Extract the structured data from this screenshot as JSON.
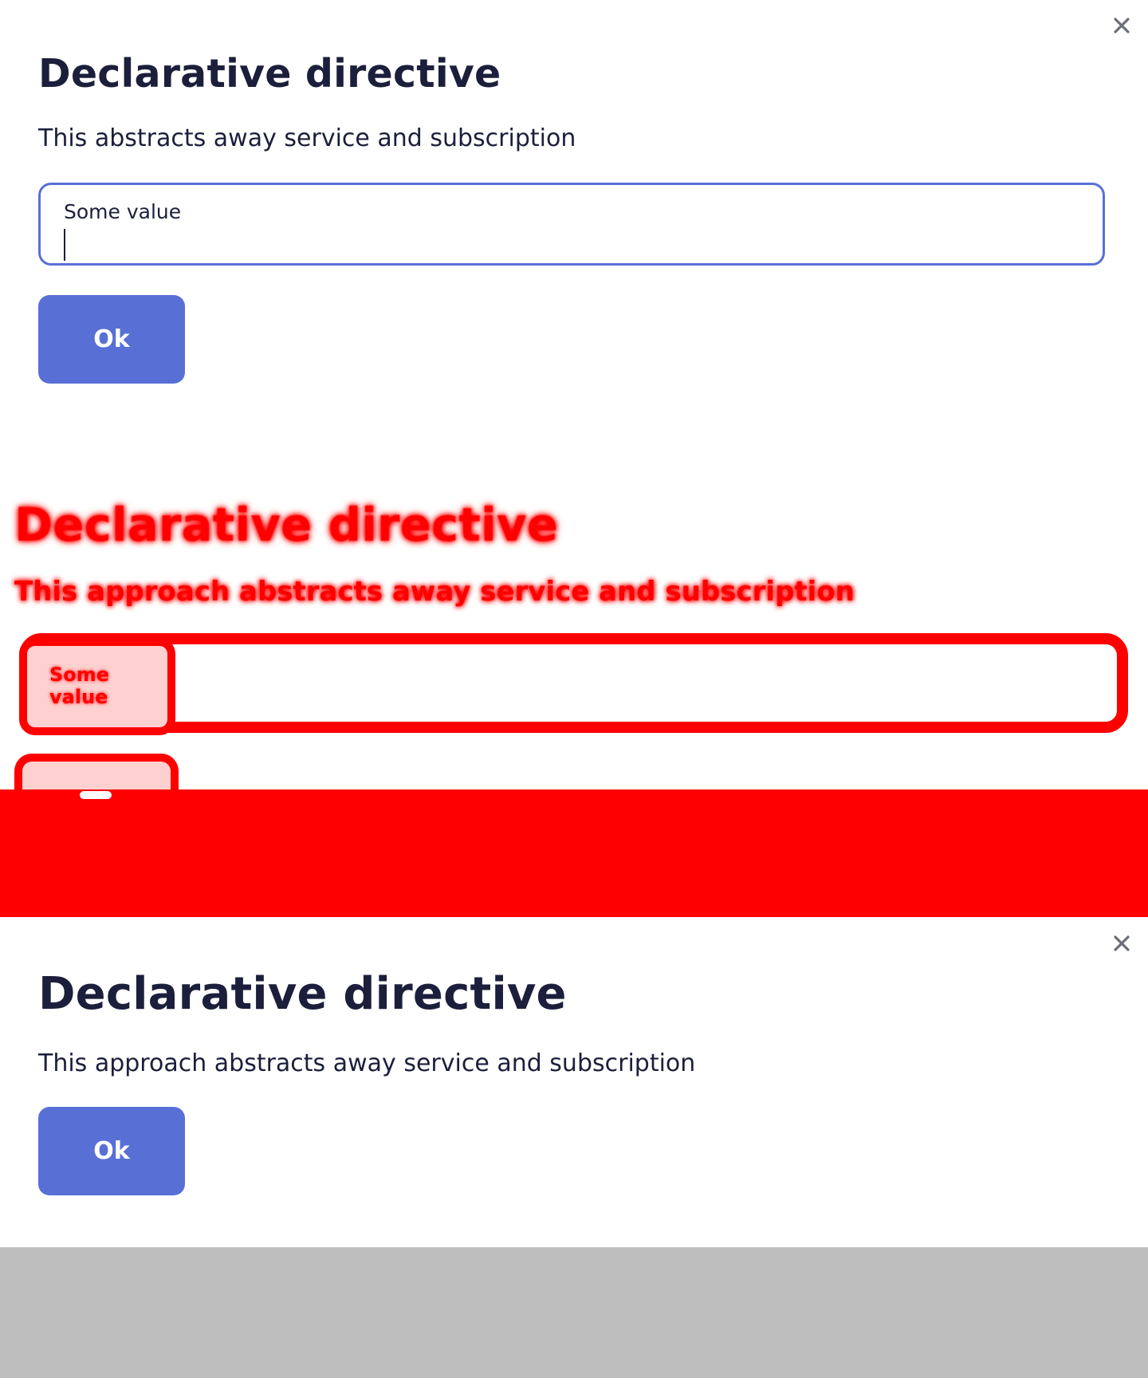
{
  "dialog_top": {
    "title": "Declarative directive",
    "description": "This abstracts away service and subscription",
    "input": {
      "label": "Some value",
      "value": "",
      "placeholder": ""
    },
    "ok_label": "Ok",
    "close_icon": "close-icon"
  },
  "diff_overlay": {
    "title": "Declarative directive",
    "description": "This approach abstracts away service and subscription",
    "input_label": "Some value",
    "ok_label": "Ok",
    "color": "#ff0000"
  },
  "dialog_bottom": {
    "title": "Declarative directive",
    "description": "This approach abstracts away service and subscription",
    "ok_label": "Ok",
    "close_icon": "close-icon"
  },
  "colors": {
    "accent": "#5870d6",
    "text": "#1b1f3b",
    "diff": "#ff0000",
    "footer": "#bebebe"
  }
}
